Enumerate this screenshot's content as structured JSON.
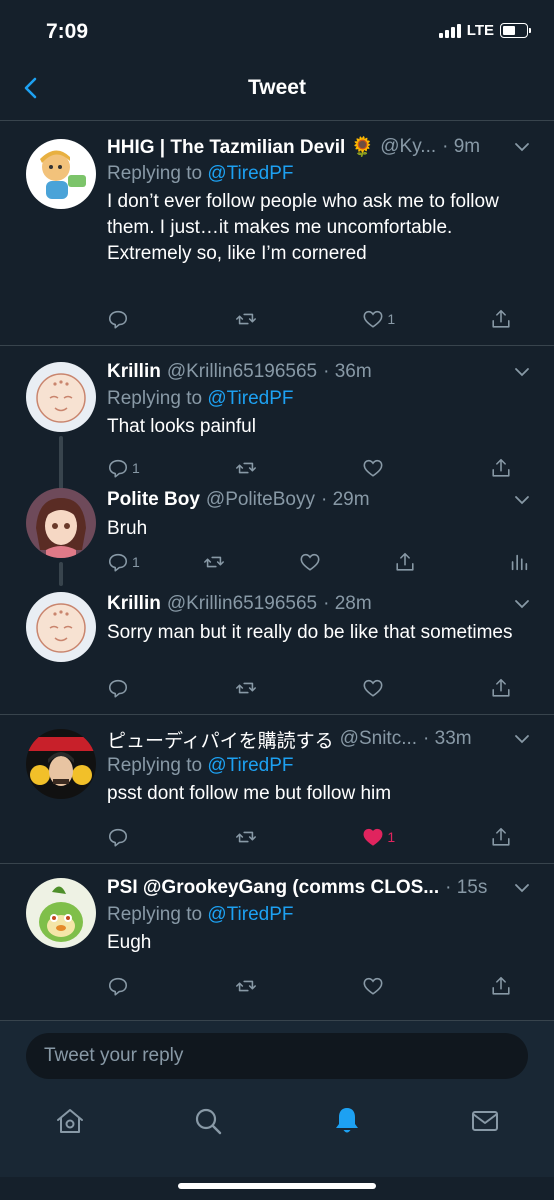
{
  "status": {
    "time": "7:09",
    "network": "LTE",
    "battery_level": 0.6
  },
  "nav": {
    "title": "Tweet"
  },
  "tweets": [
    {
      "name": "HHIG | The Tazmilian Devil 🌻",
      "handle": "@Ky...",
      "time": "· 9m",
      "replying_prefix": "Replying to ",
      "replying_to": "@TiredPF",
      "text": "I don’t ever follow people who ask me to follow them. I just…it makes me uncomfortable. Extremely so, like I’m cornered",
      "reply_count": "",
      "retweet_count": "",
      "like_count": "1",
      "liked": false,
      "colors": {
        "avatar_bg": "#ffffff"
      }
    },
    {
      "name": "Krillin",
      "handle": "@Krillin65196565",
      "time": "· 36m",
      "replying_prefix": "Replying to ",
      "replying_to": "@TiredPF",
      "text": "That looks painful",
      "reply_count": "1",
      "retweet_count": "",
      "like_count": "",
      "liked": false
    },
    {
      "name": "Polite Boy",
      "handle": "@PoliteBoyy",
      "time": "· 29m",
      "text": "Bruh",
      "reply_count": "1",
      "retweet_count": "",
      "like_count": "",
      "liked": false
    },
    {
      "name": "Krillin",
      "handle": "@Krillin65196565",
      "time": "· 28m",
      "text": "Sorry man but it really do be like that sometimes",
      "reply_count": "",
      "retweet_count": "",
      "like_count": "",
      "liked": false
    },
    {
      "name": "ピューディパイを購読する",
      "handle": "@Snitc...",
      "time": "· 33m",
      "replying_prefix": "Replying to ",
      "replying_to": "@TiredPF",
      "text": "psst dont follow me but follow him",
      "reply_count": "",
      "retweet_count": "",
      "like_count": "1",
      "liked": true
    },
    {
      "name": "PSI @GrookeyGang (comms CLOS...",
      "handle": "",
      "time": "· 15s",
      "replying_prefix": "Replying to ",
      "replying_to": "@TiredPF",
      "text": "Eugh",
      "reply_count": "",
      "retweet_count": "",
      "like_count": "",
      "liked": false
    }
  ],
  "compose": {
    "placeholder": "Tweet your reply"
  },
  "tabbar": {
    "items": [
      "home-icon",
      "search-icon",
      "notifications-icon",
      "messages-icon"
    ],
    "active": "notifications-icon"
  },
  "colors": {
    "background": "#15202b",
    "accent": "#1da1f2",
    "muted": "#8899a6",
    "like": "#e0245e",
    "divider": "#38444d"
  }
}
